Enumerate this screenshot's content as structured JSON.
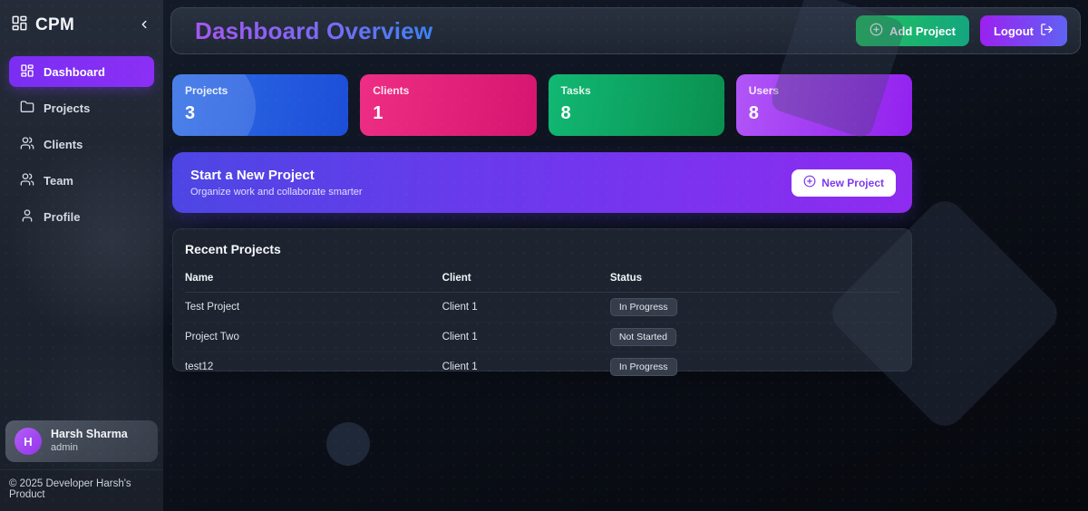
{
  "app": {
    "brand": "CPM"
  },
  "sidebar": {
    "items": [
      {
        "label": "Dashboard",
        "icon": "dashboard-grid-icon",
        "active": true
      },
      {
        "label": "Projects",
        "icon": "folder-icon",
        "active": false
      },
      {
        "label": "Clients",
        "icon": "users-icon",
        "active": false
      },
      {
        "label": "Team",
        "icon": "users-icon",
        "active": false
      },
      {
        "label": "Profile",
        "icon": "user-icon",
        "active": false
      }
    ],
    "user": {
      "initial": "H",
      "name": "Harsh Sharma",
      "role": "admin"
    },
    "footer": "© 2025 Developer Harsh's Product"
  },
  "header": {
    "title": "Dashboard Overview",
    "add_project_label": "Add Project",
    "logout_label": "Logout"
  },
  "stats": [
    {
      "label": "Projects",
      "value": "3",
      "color_from": "#2e6ce6",
      "color_to": "#1c4ed8"
    },
    {
      "label": "Clients",
      "value": "1",
      "color_from": "#ee2e84",
      "color_to": "#d61570"
    },
    {
      "label": "Tasks",
      "value": "8",
      "color_from": "#11b873",
      "color_to": "#0a8f4f"
    },
    {
      "label": "Users",
      "value": "8",
      "color_from": "#b156f7",
      "color_to": "#9220ef"
    }
  ],
  "banner": {
    "title": "Start a New Project",
    "subtitle": "Organize work and collaborate smarter",
    "button_label": "New Project"
  },
  "recent": {
    "title": "Recent Projects",
    "columns": [
      "Name",
      "Client",
      "Status"
    ],
    "rows": [
      {
        "name": "Test Project",
        "client": "Client 1",
        "status": "In Progress"
      },
      {
        "name": "Project Two",
        "client": "Client 1",
        "status": "Not Started"
      },
      {
        "name": "test12",
        "client": "Client 1",
        "status": "In Progress"
      }
    ]
  },
  "colors": {
    "accent_purple": "#8b2ff5",
    "title_gradient_from": "#a557f2",
    "title_gradient_to": "#3b82f6",
    "add_button_from": "#21c35d",
    "add_button_to": "#14a57f",
    "logout_from": "#9c20f0",
    "logout_to": "#5f63f3",
    "banner_from": "#4d46e4",
    "banner_to": "#8f2bf0"
  }
}
